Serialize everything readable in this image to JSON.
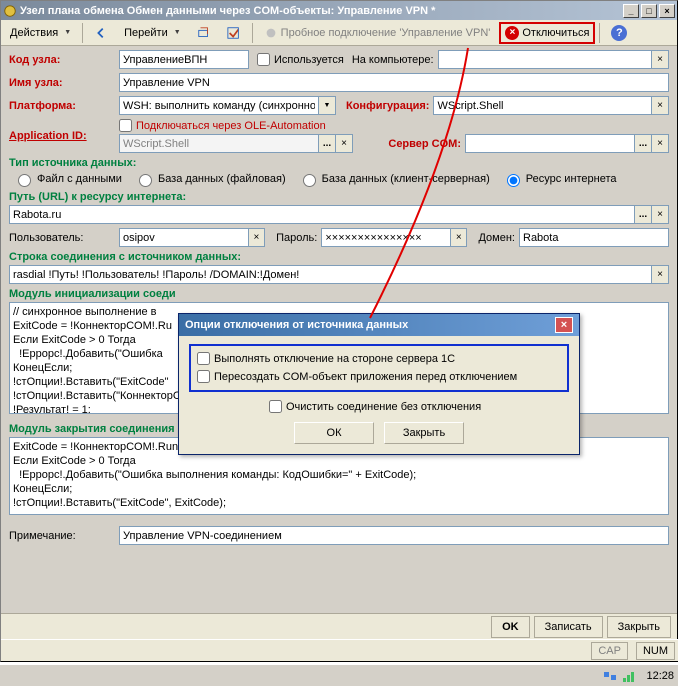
{
  "title": "Узел плана обмена Обмен данными через COM-объекты: Управление VPN *",
  "toolbar": {
    "actions": "Действия",
    "go": "Перейти",
    "test_conn": "Пробное подключение 'Управление VPN'",
    "disconnect": "Отключиться"
  },
  "fields": {
    "code_label": "Код узла:",
    "code_value": "УправлениеВПН",
    "used_label": "Используется",
    "on_computer_label": "На компьютере:",
    "on_computer_value": "",
    "name_label": "Имя узла:",
    "name_value": "Управление VPN",
    "platform_label": "Платформа:",
    "platform_value": "WSH: выполнить команду (синхронно)",
    "config_label": "Конфигурация:",
    "config_value": "WScript.Shell",
    "appid_label": "Application ID:",
    "ole_conn_label": "Подключаться через OLE-Automation",
    "appid_value": "WScript.Shell",
    "com_server_label": "Сервер COM:",
    "com_server_value": ""
  },
  "source": {
    "header": "Тип источника данных:",
    "opt_file": "Файл с данными",
    "opt_db_file": "База данных (файловая)",
    "opt_db_cs": "База данных (клиент-серверная)",
    "opt_internet": "Ресурс интернета",
    "url_label": "Путь (URL) к ресурсу интернета:",
    "url_value": "Rabota.ru",
    "user_label": "Пользователь:",
    "user_value": "osipov",
    "pass_label": "Пароль:",
    "pass_value": "×××××××××××××××",
    "domain_label": "Домен:",
    "domain_value": "Rabota"
  },
  "conn_string": {
    "label": "Строка соединения с источником данных:",
    "value": "rasdial !Путь! !Пользователь! !Пароль! /DOMAIN:!Домен!"
  },
  "init_module": {
    "label": "Модуль инициализации соеди",
    "code": "// синхронное выполнение в\nExitCode = !КоннекторCOM!.Ru\nЕсли ExitCode > 0 Тогда\n  !Еррорс!.Добавить(\"Ошибка\nКонецЕсли;\n!стОпции!.Вставить(\"ExitCode\"\n!стОпции!.Вставить(\"КоннекторCOM\n!Результат! = 1;"
  },
  "close_module": {
    "label": "Модуль закрытия соединения с источником данных:",
    "code": "ExitCode = !КоннекторCOM!.Run(\"rasdial \"\" + !Путь! + \"\" /DISCONNECT\", 2, Истина);\nЕсли ExitCode > 0 Тогда\n  !Еррорс!.Добавить(\"Ошибка выполнения команды: КодОшибки=\" + ExitCode);\nКонецЕсли;\n!стОпции!.Вставить(\"ExitCode\", ExitCode);"
  },
  "note": {
    "label": "Примечание:",
    "value": "Управление VPN-соединением"
  },
  "footer": {
    "ok": "OK",
    "save": "Записать",
    "close": "Закрыть"
  },
  "modal": {
    "title": "Опции отключения от источника данных",
    "chk1": "Выполнять отключение на стороне сервера 1С",
    "chk2": "Пересоздать COM-объект приложения перед отключением",
    "chk3": "Очистить соединение без отключения",
    "ok": "ОК",
    "close": "Закрыть"
  },
  "status": {
    "cap": "CAP",
    "num": "NUM"
  },
  "tray": {
    "time": "12:28"
  }
}
